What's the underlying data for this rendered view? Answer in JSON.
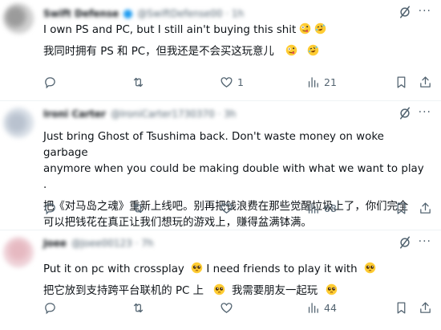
{
  "replies": [
    {
      "author_name": "Swift Defense",
      "author_handle": "@SwiftDefense00 · 1h",
      "text_en": "I own PS and PC, but I still ain't buying this shit",
      "text_zh": "我同时拥有 PS 和 PC，但我还是不会买这玩意儿",
      "emoji_en": [
        "zany-face-emoji",
        "rolling-laughing-emoji"
      ],
      "emoji_zh": [
        "zany-face-emoji",
        "rolling-laughing-emoji"
      ],
      "stats": {
        "replies": "",
        "reposts": "",
        "likes": "1",
        "views": "21"
      }
    },
    {
      "author_name": "Ironi Carter",
      "author_handle": "@IroniCarter1730370 · 3h",
      "text_en": "Just bring Ghost of Tsushima back. Don't waste money on woke garbage\nanymore when you could be making double with what we want to play .",
      "text_zh": "把《对马岛之魂》重新上线吧。别再把钱浪费在那些觉醒垃圾上了，你们完全\n可以把钱花在真正让我们想玩的游戏上，赚得盆满钵满。",
      "stats": {
        "replies": "",
        "reposts": "",
        "likes": "",
        "views": "68"
      }
    },
    {
      "author_name": "Joee",
      "author_handle": "@Joee00123 · 7h",
      "text_en": "Put it on pc with crossplay",
      "text_en_2": " I need friends to play it with",
      "text_zh": "把它放到支持跨平台联机的 PC 上",
      "text_zh_2": "我需要朋友一起玩",
      "stats": {
        "replies": "",
        "reposts": "",
        "likes": "",
        "views": "44"
      }
    }
  ],
  "icons": {
    "grok": "grok-icon",
    "more": "more-icon",
    "reply": "reply-icon",
    "repost": "repost-icon",
    "like": "heart-icon",
    "views": "views-icon",
    "bookmark": "bookmark-icon",
    "share": "share-icon"
  },
  "colors": {
    "text": "#0f1419",
    "secondary": "#536471",
    "divider": "#eff3f4",
    "verified": "#1d9bf0"
  }
}
